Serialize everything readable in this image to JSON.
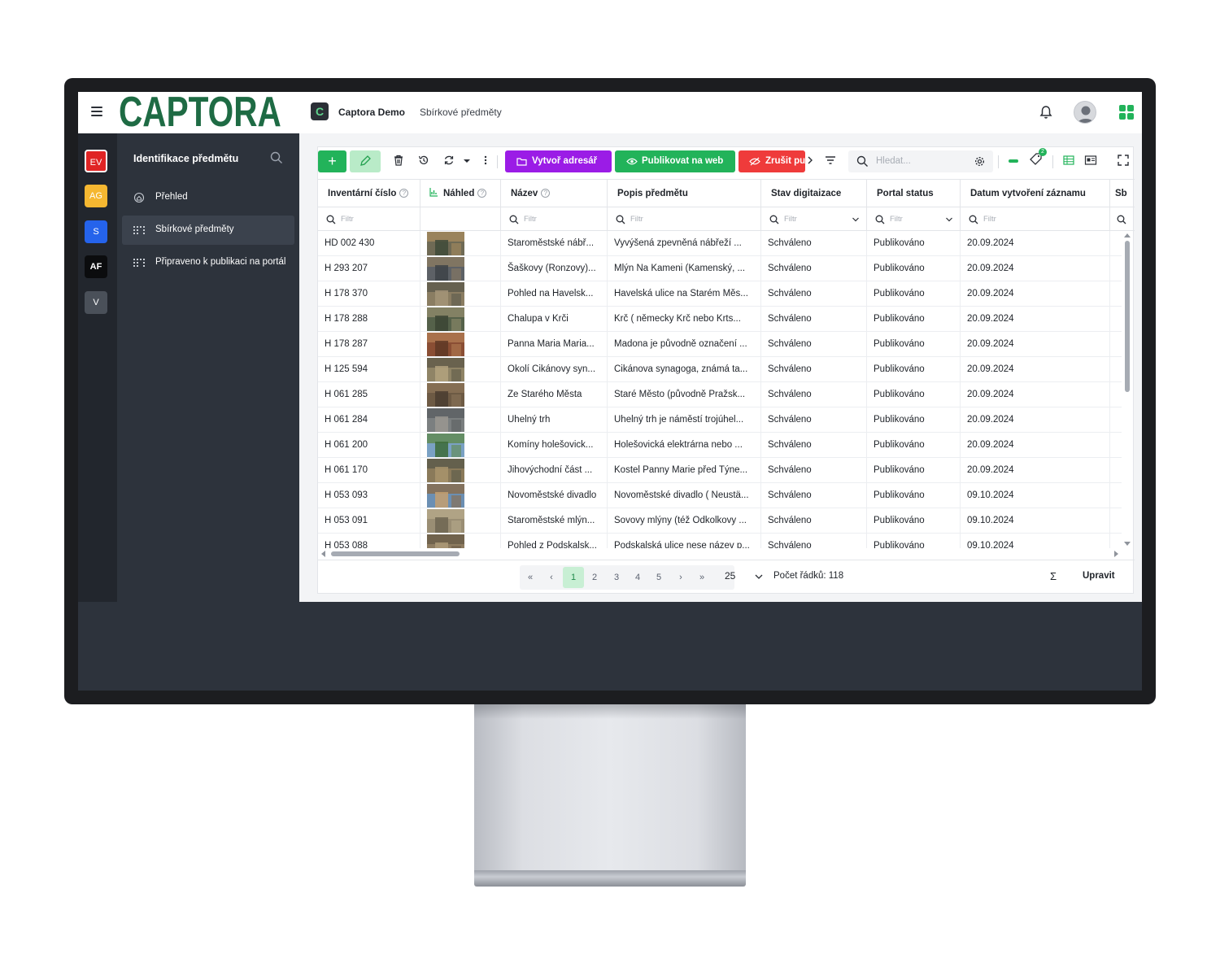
{
  "brand": {
    "logo": "CAPTORA",
    "app_badge": "C"
  },
  "topbar": {
    "app_title": "Captora Demo",
    "breadcrumb": "Sbírkové předměty"
  },
  "rail": [
    {
      "label": "EV",
      "color": "#e02424"
    },
    {
      "label": "AG",
      "color": "#f5b731"
    },
    {
      "label": "S",
      "color": "#2563eb"
    },
    {
      "label": "AF",
      "color": "#0b0c0e"
    },
    {
      "label": "V",
      "color": "#4a5059"
    }
  ],
  "nav": {
    "heading": "Identifikace předmětu",
    "items": [
      {
        "label": "Přehled",
        "icon": "home-icon"
      },
      {
        "label": "Sbírkové předměty",
        "icon": "grid-dots-icon",
        "active": true
      },
      {
        "label": "Připraveno k publikaci na portál",
        "icon": "grid-dots-icon"
      }
    ]
  },
  "toolbar": {
    "create_address": "Vytvoř adresář",
    "publish_web": "Publikovat na web",
    "cancel_publish": "Zrušit pu",
    "search_placeholder": "Hledat...",
    "tag_badge": "2"
  },
  "columns": [
    "Inventární číslo",
    "Náhled",
    "Název",
    "Popis předmětu",
    "Stav digitaizace",
    "Portal status",
    "Datum vytvoření záznamu",
    "Sb"
  ],
  "filter_placeholder": "Filtr",
  "rows": [
    {
      "inv": "HD 002 430",
      "name": "Staroměstské nábř...",
      "desc": "Vyvýšená zpevněná  nábřeží  ...",
      "stav": "Schváleno",
      "portal": "Publikováno",
      "date": "20.09.2024",
      "thumb": [
        "#6f6a55",
        "#a58a5e",
        "#3f4a3a"
      ]
    },
    {
      "inv": "H 293 207",
      "name": "Šaškovy (Ronzovy)...",
      "desc": "Mlýn Na Kameni  (Kamenský, ...",
      "stav": "Schváleno",
      "portal": "Publikováno",
      "date": "20.09.2024",
      "thumb": [
        "#5d6166",
        "#8a7a62",
        "#3d4348"
      ]
    },
    {
      "inv": "H 178 370",
      "name": "Pohled na Havelsk...",
      "desc": "Havelská ulice na  Starém Měs...",
      "stav": "Schváleno",
      "portal": "Publikováno",
      "date": "20.09.2024",
      "thumb": [
        "#8a7d62",
        "#5c5a4c",
        "#a39478"
      ]
    },
    {
      "inv": "H 178 288",
      "name": "Chalupa v Krči",
      "desc": "Krč ( německy  Krč nebo  Krts...",
      "stav": "Schváleno",
      "portal": "Publikováno",
      "date": "20.09.2024",
      "thumb": [
        "#55614a",
        "#8e8a6a",
        "#3c4534"
      ]
    },
    {
      "inv": "H 178 287",
      "name": "Panna Maria Maria...",
      "desc": "Madona je původně označení ...",
      "stav": "Schváleno",
      "portal": "Publikováno",
      "date": "20.09.2024",
      "thumb": [
        "#8a4e34",
        "#b07a52",
        "#5e3826"
      ]
    },
    {
      "inv": "H 125 594",
      "name": "Okolí Cikánovy syn...",
      "desc": "Cikánova synagoga, známá ta...",
      "stav": "Schváleno",
      "portal": "Publikováno",
      "date": "20.09.2024",
      "thumb": [
        "#8f8466",
        "#5f5a48",
        "#b3a27e"
      ]
    },
    {
      "inv": "H 061 285",
      "name": "Ze Starého Města",
      "desc": "Staré Město (původně  Pražsk...",
      "stav": "Schváleno",
      "portal": "Publikováno",
      "date": "20.09.2024",
      "thumb": [
        "#6d5a44",
        "#8b7358",
        "#4a3d30"
      ]
    },
    {
      "inv": "H 061 284",
      "name": "Uhelný trh",
      "desc": "Uhelný trh je náměstí  trojúhel...",
      "stav": "Schváleno",
      "portal": "Publikováno",
      "date": "20.09.2024",
      "thumb": [
        "#7b7f80",
        "#5b5f61",
        "#9a9690"
      ]
    },
    {
      "inv": "H 061 200",
      "name": "Komíny holešovick...",
      "desc": "Holešovická elektrárna nebo  ...",
      "stav": "Schváleno",
      "portal": "Publikováno",
      "date": "20.09.2024",
      "thumb": [
        "#7aa1c4",
        "#5f8a4e",
        "#3c6b38"
      ]
    },
    {
      "inv": "H 061 170",
      "name": "Jihovýchodní část ...",
      "desc": "Kostel Panny Marie před Týne...",
      "stav": "Schváleno",
      "portal": "Publikováno",
      "date": "20.09.2024",
      "thumb": [
        "#8a7a5a",
        "#5a5a4a",
        "#a8946c"
      ]
    },
    {
      "inv": "H 053 093",
      "name": "Novoměstské divadlo",
      "desc": "Novoměstské divadlo ( Neustä...",
      "stav": "Schváleno",
      "portal": "Publikováno",
      "date": "09.10.2024",
      "thumb": [
        "#6b8fb3",
        "#8a6a48",
        "#c4a070"
      ]
    },
    {
      "inv": "H 053 091",
      "name": "Staroměstské mlýn...",
      "desc": "Sovovy mlýny (též  Odkolkovy ...",
      "stav": "Schváleno",
      "portal": "Publikováno",
      "date": "09.10.2024",
      "thumb": [
        "#9a8e74",
        "#b5a98a",
        "#6e6652"
      ]
    },
    {
      "inv": "H 053 088",
      "name": "Pohled z Podskalsk...",
      "desc": "Podskalská ulice nese název p...",
      "stav": "Schváleno",
      "portal": "Publikováno",
      "date": "09.10.2024",
      "thumb": [
        "#8e7c60",
        "#6a5c48",
        "#ad9a78"
      ]
    }
  ],
  "pagination": {
    "pages": [
      "1",
      "2",
      "3",
      "4",
      "5"
    ],
    "active": "1",
    "page_size": "25",
    "row_count": "Počet řádků: 118",
    "sigma": "Σ",
    "edit": "Upravit"
  },
  "colors": {
    "accent_green": "#22b35a",
    "purple": "#9b1ce6",
    "red": "#ef3b3b",
    "nav_bg": "#2d333c"
  }
}
